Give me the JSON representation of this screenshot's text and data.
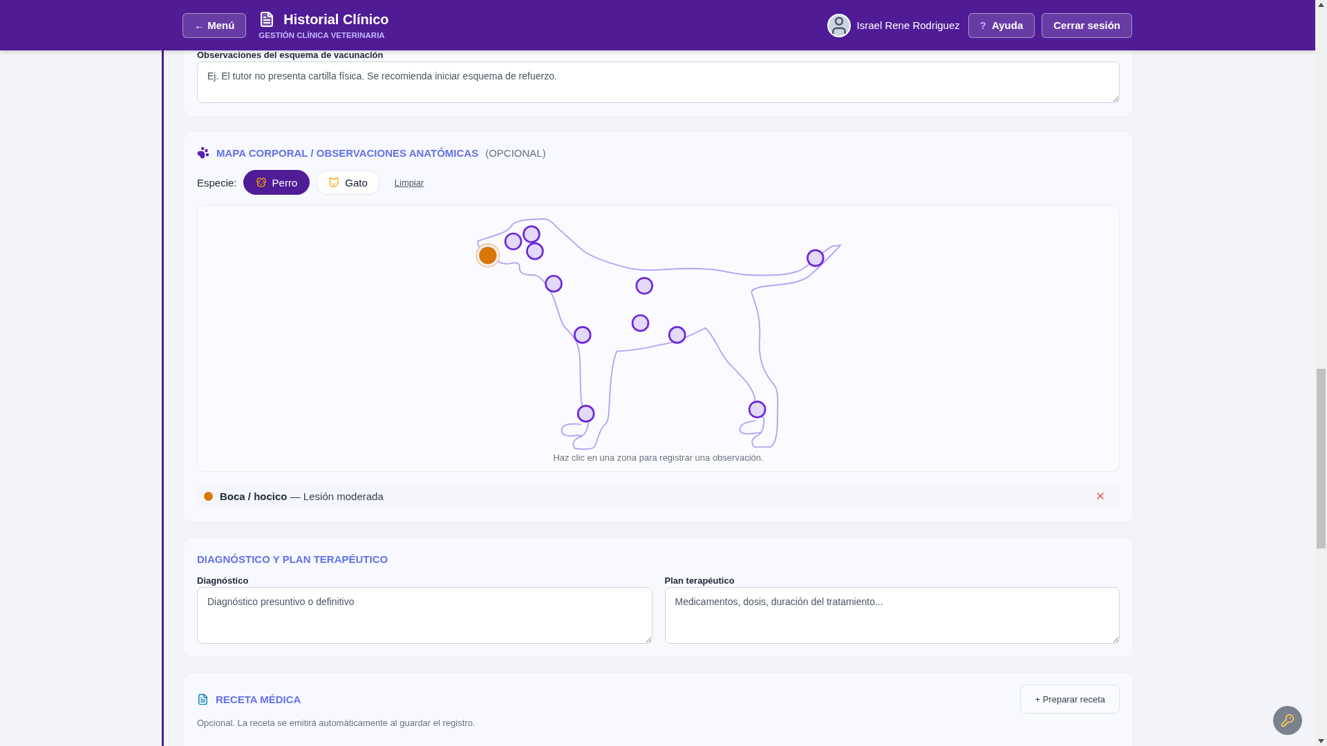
{
  "header": {
    "menu_button": "← Menú",
    "title": "Historial Clínico",
    "subtitle": "GESTIÓN CLÍNICA VETERINARIA",
    "user_name": "Israel Rene Rodriguez",
    "help_icon": "?",
    "help_button": "Ayuda",
    "logout_button": "Cerrar sesión"
  },
  "vaccination_notes": {
    "label": "Observaciones del esquema de vacunación",
    "placeholder": "Ej. El tutor no presenta cartilla física. Se recomienda iniciar esquema de refuerzo."
  },
  "body_map": {
    "title": "MAPA CORPORAL / OBSERVACIONES ANATÓMICAS",
    "optional": "(OPCIONAL)",
    "species_label": "Especie:",
    "species": [
      {
        "kind": "dog",
        "label": "Perro",
        "selected": true
      },
      {
        "kind": "cat",
        "label": "Gato",
        "selected": false
      }
    ],
    "clear_link": "Limpiar",
    "zones": [
      {
        "selected": true
      },
      {
        "selected": false
      },
      {
        "selected": false
      },
      {
        "selected": false
      },
      {
        "selected": false
      },
      {
        "selected": false
      },
      {
        "selected": false
      },
      {
        "selected": false
      },
      {
        "selected": false
      },
      {
        "selected": false
      },
      {
        "selected": false
      },
      {
        "selected": false
      }
    ],
    "hint": "Haz clic en una zona para registrar una observación.",
    "observations": [
      {
        "text": "**Boca / hocico** — Lesión moderada",
        "color": "#d97706"
      }
    ]
  },
  "diagnosis": {
    "title": "DIAGNÓSTICO Y PLAN TERAPÉUTICO",
    "fields": [
      {
        "label": "Diagnóstico",
        "placeholder": "Diagnóstico presuntivo o definitivo"
      },
      {
        "label": "Plan terapéutico",
        "placeholder": "Medicamentos, dosis, duración del tratamiento..."
      }
    ]
  },
  "prescription": {
    "title": "RECETA MÉDICA",
    "button": "+ Preparar receta",
    "note": "Opcional. La receta se emitirá automáticamente al guardar el registro."
  }
}
